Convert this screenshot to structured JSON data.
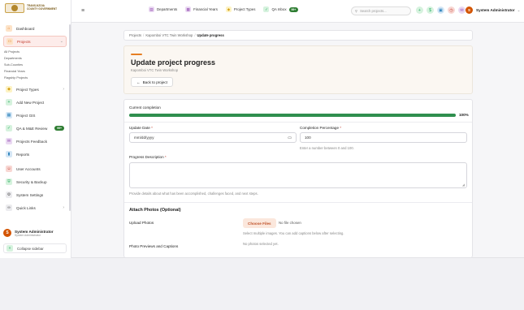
{
  "brand": {
    "logo_text_line1": "TRANS-NZOIA",
    "logo_text_line2": "COUNTY GOVERNMENT"
  },
  "sidebar": {
    "items": [
      {
        "label": "Dashboard",
        "icon": "home-icon",
        "color": "#e67e22"
      },
      {
        "label": "Projects",
        "icon": "folder-icon",
        "color": "#e67e22",
        "active": true
      },
      {
        "label": "Project Types",
        "icon": "tag-icon",
        "color": "#f1c40f"
      },
      {
        "label": "Add New Project",
        "icon": "plus-icon",
        "color": "#27ae60"
      },
      {
        "label": "Project GIS",
        "icon": "map-icon",
        "color": "#2980b9"
      },
      {
        "label": "QA & M&E Review",
        "icon": "check-circle-icon",
        "color": "#27ae60",
        "badge": "99+"
      },
      {
        "label": "Projects Feedback",
        "icon": "chat-icon",
        "color": "#8e44ad"
      },
      {
        "label": "Reports",
        "icon": "chart-icon",
        "color": "#2980b9"
      },
      {
        "label": "User Accounts",
        "icon": "users-icon",
        "color": "#c0392b"
      },
      {
        "label": "Security & Backup",
        "icon": "shield-icon",
        "color": "#27ae60"
      },
      {
        "label": "System Settings",
        "icon": "gear-icon",
        "color": "#555555"
      },
      {
        "label": "Quick Links",
        "icon": "link-icon",
        "color": "#555555"
      }
    ],
    "sub_items": [
      "All Projects",
      "Departments",
      "Sub-Counties",
      "Financial Years",
      "Flagship Projects"
    ],
    "user": {
      "initial": "S",
      "name": "System Administrator",
      "role": "System Administrator"
    },
    "collapse_label": "Collapse sidebar"
  },
  "topbar": {
    "links": [
      {
        "label": "Departments",
        "icon": "building-icon",
        "color": "#8e44ad"
      },
      {
        "label": "Financial Years",
        "icon": "calendar-icon",
        "color": "#8e44ad"
      },
      {
        "label": "Project Types",
        "icon": "tag-icon",
        "color": "#f1c40f"
      },
      {
        "label": "QA Inbox",
        "icon": "inbox-icon",
        "color": "#27ae60",
        "badge": "99+"
      }
    ],
    "search_placeholder": "Search projects...",
    "icons": [
      {
        "name": "add-icon",
        "color": "#27ae60"
      },
      {
        "name": "money-icon",
        "color": "#27ae60"
      },
      {
        "name": "qr-icon",
        "color": "#2980b9"
      },
      {
        "name": "clock-icon",
        "color": "#c0392b"
      },
      {
        "name": "chat-icon",
        "color": "#8e44ad"
      }
    ],
    "user": {
      "initial": "S",
      "name": "System Administrator"
    }
  },
  "breadcrumb": {
    "root": "Projects",
    "project": "Kapomboi VTC Twin Workshop",
    "current": "Update progress"
  },
  "hero": {
    "title": "Update project progress",
    "subtitle": "Kapomboi VTC Twin Workshop",
    "back_label": "Back to project"
  },
  "form": {
    "current_label": "Current completion",
    "progress": 100,
    "progress_text": "100%",
    "date_label": "Update Date",
    "date_value": "mm/dd/yyyy",
    "pct_label": "Completion Percentage",
    "pct_value": "100",
    "pct_hint": "Enter a number between 0 and 100.",
    "desc_label": "Progress Description",
    "desc_hint": "Provide details about what has been accomplished, challenges faced, and next steps.",
    "photos_section": "Attach Photos (Optional)",
    "upload_label": "Upload Photos",
    "choose_label": "Choose Files",
    "no_file": "No file chosen",
    "upload_hint": "Select multiple images. You can add captions below after selecting.",
    "previews_label": "Photo Previews and Captions",
    "previews_empty": "No photos selected yet.",
    "required_mark": "*",
    "colors": {
      "accent": "#e67e22",
      "progress": "#2f8f4e",
      "danger": "#c0392b"
    }
  }
}
